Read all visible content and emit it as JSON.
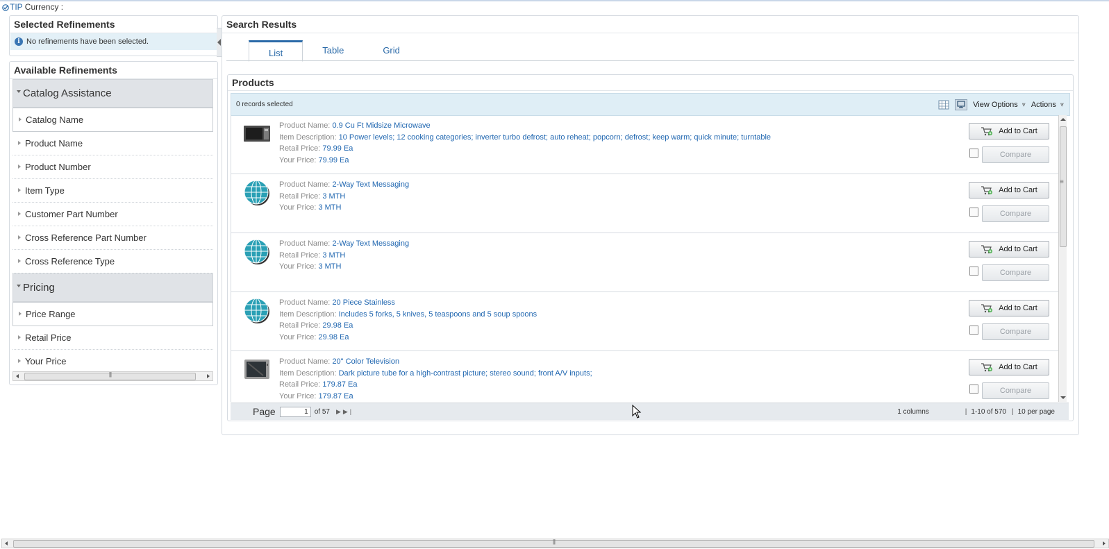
{
  "tip": {
    "prefix": "TIP",
    "label": "Currency :"
  },
  "selected_refinements": {
    "title": "Selected Refinements",
    "message": "No refinements have been selected."
  },
  "available_refinements": {
    "title": "Available Refinements",
    "groups": [
      {
        "label": "Catalog Assistance",
        "items": [
          "Catalog Name",
          "Product Name",
          "Product Number",
          "Item Type",
          "Customer Part Number",
          "Cross Reference Part Number",
          "Cross Reference Type"
        ]
      },
      {
        "label": "Pricing",
        "items": [
          "Price Range",
          "Retail Price",
          "Your Price"
        ]
      }
    ]
  },
  "search_results": {
    "title": "Search Results",
    "tabs": [
      "List",
      "Table",
      "Grid"
    ],
    "active_tab": "List"
  },
  "products": {
    "title": "Products",
    "records_selected": "0 records selected",
    "view_options": "View Options",
    "actions": "Actions",
    "add_to_cart": "Add to Cart",
    "compare": "Compare",
    "labels": {
      "name": "Product Name:",
      "description": "Item Description:",
      "retail": "Retail Price:",
      "your": "Your Price:"
    },
    "items": [
      {
        "image": "microwave",
        "name": "0.9 Cu Ft Midsize Microwave",
        "description": "10 Power levels; 12 cooking categories; inverter turbo defrost; auto reheat; popcorn; defrost; keep warm; quick minute; turntable",
        "retail": "79.99 Ea",
        "your": "79.99 Ea"
      },
      {
        "image": "globe",
        "name": "2-Way Text Messaging",
        "retail": "3 MTH",
        "your": "3 MTH"
      },
      {
        "image": "globe",
        "name": "2-Way Text Messaging",
        "retail": "3 MTH",
        "your": "3 MTH"
      },
      {
        "image": "globe",
        "name": "20 Piece Stainless",
        "description": "Includes 5 forks, 5 knives, 5 teaspoons and 5 soup spoons",
        "retail": "29.98 Ea",
        "your": "29.98 Ea"
      },
      {
        "image": "television",
        "name": "20\" Color Television",
        "description": "Dark picture tube for a high-contrast picture; stereo sound; front A/V inputs;",
        "retail": "179.87 Ea",
        "your": "179.87 Ea"
      }
    ]
  },
  "pager": {
    "page_label": "Page",
    "current_page": "1",
    "of_pages": "of 57",
    "columns": "1 columns",
    "range": "1-10 of 570",
    "per_page": "10 per page"
  },
  "colors": {
    "accent": "#1f66b0",
    "toolbar_bg": "#dfeef6",
    "group_bg": "#e0e3e7"
  }
}
